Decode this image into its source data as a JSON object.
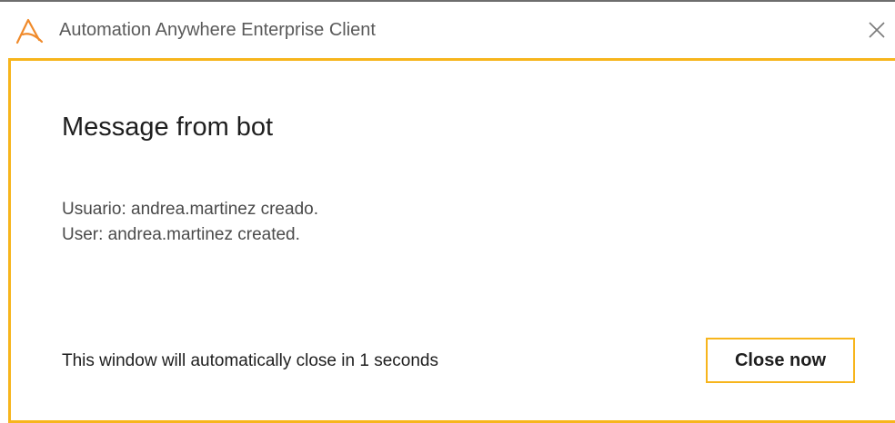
{
  "window": {
    "title": "Automation Anywhere Enterprise Client",
    "logo_icon": "automation-anywhere-logo-icon",
    "close_icon": "close-icon"
  },
  "dialog": {
    "heading": "Message from bot",
    "message_lines": [
      "Usuario: andrea.martinez creado.",
      "User: andrea.martinez created."
    ],
    "countdown_text": "This window will automatically close in 1 seconds",
    "close_now_label": "Close now"
  },
  "colors": {
    "accent": "#f7b51c",
    "logo": "#f08a2a"
  }
}
